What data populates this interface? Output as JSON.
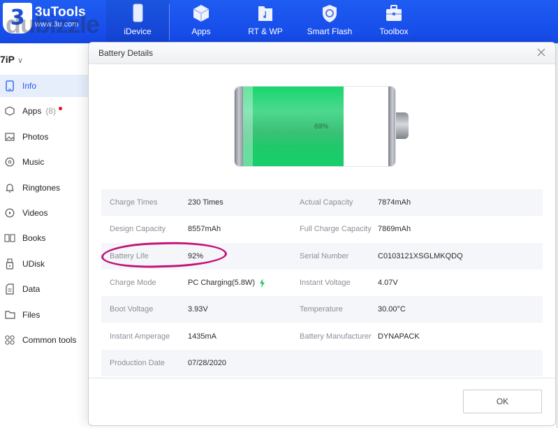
{
  "app": {
    "logo_glyph": "3",
    "brand_name": "3uTools",
    "brand_url": "www.3u.com",
    "watermark": "dubizzle"
  },
  "topnav": {
    "items": [
      {
        "label": "iDevice",
        "icon": "phone-icon"
      },
      {
        "label": "Apps",
        "icon": "cube-icon"
      },
      {
        "label": "RT & WP",
        "icon": "music-folder-icon"
      },
      {
        "label": "Smart Flash",
        "icon": "shield-refresh-icon"
      },
      {
        "label": "Toolbox",
        "icon": "toolbox-icon"
      }
    ]
  },
  "sidebar": {
    "device_name": "7iP",
    "device_chevron": "∨",
    "items": [
      {
        "label": "Info",
        "icon": "phone-outline-icon",
        "active": true
      },
      {
        "label": "Apps",
        "icon": "hexagon-app-icon",
        "count": "(8)",
        "badge": true
      },
      {
        "label": "Photos",
        "icon": "image-icon"
      },
      {
        "label": "Music",
        "icon": "disc-icon"
      },
      {
        "label": "Ringtones",
        "icon": "bell-icon"
      },
      {
        "label": "Videos",
        "icon": "play-circle-icon"
      },
      {
        "label": "Books",
        "icon": "book-icon"
      },
      {
        "label": "UDisk",
        "icon": "usb-drive-icon"
      },
      {
        "label": "Data",
        "icon": "document-icon"
      },
      {
        "label": "Files",
        "icon": "folder-icon"
      },
      {
        "label": "Common tools",
        "icon": "grid-circles-icon"
      }
    ]
  },
  "dialog": {
    "title": "Battery Details",
    "battery_percent": 69,
    "battery_percent_label": "69%",
    "rows": [
      {
        "label": "Charge Times",
        "value": "230 Times",
        "label2": "Actual Capacity",
        "value2": "7874mAh"
      },
      {
        "label": "Design Capacity",
        "value": "8557mAh",
        "label2": "Full Charge Capacity",
        "value2": "7869mAh"
      },
      {
        "label": "Battery Life",
        "value": "92%",
        "label2": "Serial Number",
        "value2": "C0103121XSGLMKQDQ"
      },
      {
        "label": "Charge Mode",
        "value": "PC Charging(5.8W)",
        "label2": "Instant Voltage",
        "value2": "4.07V",
        "charging_icon": true
      },
      {
        "label": "Boot Voltage",
        "value": "3.93V",
        "label2": "Temperature",
        "value2": "30.00°C"
      },
      {
        "label": "Instant Amperage",
        "value": "1435mA",
        "label2": "Battery Manufacturer",
        "value2": "DYNAPACK"
      },
      {
        "label": "Production Date",
        "value": "07/28/2020",
        "label2": "",
        "value2": ""
      }
    ],
    "ok_label": "OK",
    "annotation_color": "#c3127a",
    "charging_color": "#22c55e"
  }
}
